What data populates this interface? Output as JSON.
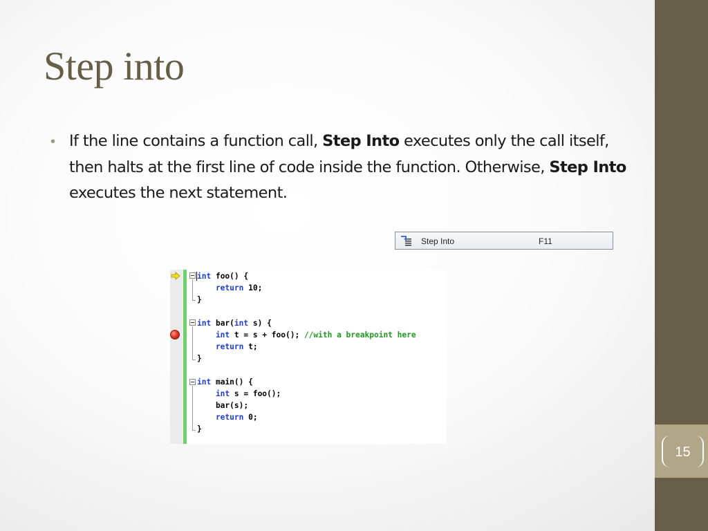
{
  "slide": {
    "title": "Step into",
    "bullet": {
      "part1": "If the line contains a function call, ",
      "bold1": "Step Into",
      "part2": " executes only the call itself, then halts at the first line of code inside the function. Otherwise, ",
      "bold2": "Step Into",
      "part3": " executes the next statement."
    },
    "page_number": "15"
  },
  "menu_item": {
    "label": "Step Into",
    "shortcut": "F11",
    "icon": "step-into-icon"
  },
  "code": {
    "lines": [
      {
        "kw": "int",
        "rest": " foo() {"
      },
      {
        "kw": "    return",
        "rest": " 10;"
      },
      {
        "text": "}"
      },
      {
        "text": ""
      },
      {
        "kw": "int",
        "rest": " bar(",
        "kw2": "int",
        "rest2": " s) {"
      },
      {
        "kw": "    int",
        "rest": " t = s + foo(); ",
        "comment": "//with a breakpoint here"
      },
      {
        "kw": "    return",
        "rest": " t;"
      },
      {
        "text": "}"
      },
      {
        "text": ""
      },
      {
        "kw": "int",
        "rest": " main() {"
      },
      {
        "kw": "    int",
        "rest": " s = foo();"
      },
      {
        "text": "    bar(s);"
      },
      {
        "kw": "    return",
        "rest": " 0;"
      },
      {
        "text": "}"
      }
    ],
    "current_line_icon": "current-statement-arrow-icon",
    "breakpoint_icon": "breakpoint-icon"
  },
  "colors": {
    "sidebar": "#675e47",
    "page_box": "#b1a688",
    "title": "#675e47",
    "keyword": "#1a3bd4",
    "comment": "#1f9a1f",
    "change_bar": "#6ad46a"
  }
}
